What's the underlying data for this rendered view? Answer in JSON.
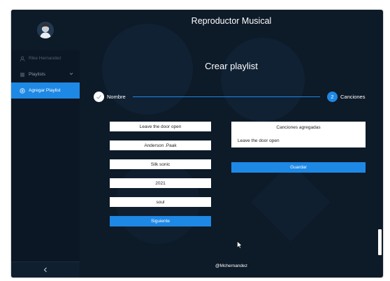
{
  "app": {
    "title": "Reproductor Musical",
    "footer": "@Mchernandez"
  },
  "sidebar": {
    "user_name": "Rike Hernandez",
    "items": [
      {
        "label": "Playlists",
        "icon": "list-icon",
        "expandable": true
      },
      {
        "label": "Agregar Playlist",
        "icon": "plus-circle-icon",
        "active": true
      }
    ]
  },
  "page": {
    "title": "Crear playlist"
  },
  "stepper": {
    "steps": [
      {
        "label": "Nombre",
        "state": "done"
      },
      {
        "number": "2",
        "label": "Canciones",
        "state": "current"
      }
    ]
  },
  "form": {
    "fields": [
      {
        "name": "song-name",
        "value": "Leave the door open"
      },
      {
        "name": "artist",
        "value": "Anderson .Paak"
      },
      {
        "name": "album",
        "value": "Silk sonic"
      },
      {
        "name": "year",
        "value": "2021"
      },
      {
        "name": "genre",
        "value": "soul"
      }
    ],
    "next_label": "Siguiente"
  },
  "added_songs": {
    "header": "Canciones agregadas",
    "items": [
      "Leave the door open"
    ],
    "save_label": "Guardar"
  },
  "colors": {
    "accent": "#1e88e5",
    "background": "#0d1a28",
    "sidebar": "#0b1724"
  }
}
